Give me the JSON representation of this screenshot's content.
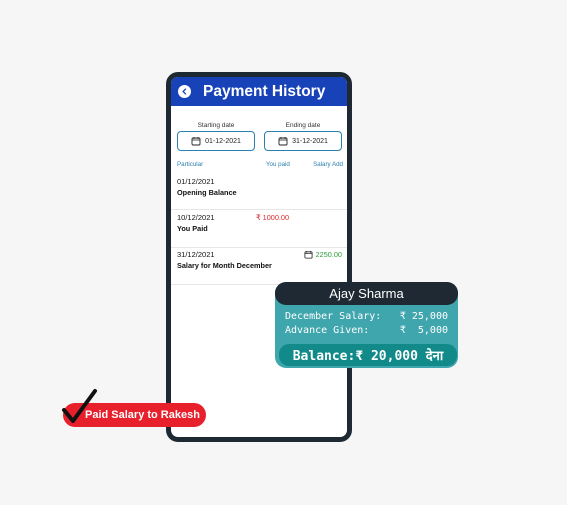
{
  "app": {
    "title": "Payment History",
    "back_icon": "chevron-left-icon",
    "header_color": "#1742b8"
  },
  "filters": {
    "start": {
      "label": "Starting date",
      "value": "01-12-2021",
      "icon": "calendar-icon"
    },
    "end": {
      "label": "Ending date",
      "value": "31-12-2021",
      "icon": "calendar-icon"
    }
  },
  "columns": {
    "particular": "Particular",
    "you_paid": "You paid",
    "salary_add": "Salary Add"
  },
  "entries": [
    {
      "date": "01/12/2021",
      "description": "Opening Balance",
      "paid": "",
      "salary": ""
    },
    {
      "date": "10/12/2021",
      "description": "You Paid",
      "paid": "₹ 1000.00",
      "salary": ""
    },
    {
      "date": "31/12/2021",
      "description": "Salary for Month December",
      "paid": "",
      "salary": "2250.00",
      "salary_icon": "receipt-icon"
    }
  ],
  "colors": {
    "paid": "#d42a2a",
    "salary": "#2d9a3a",
    "accent": "#2a7fb0"
  },
  "balance_card": {
    "name": "Ajay Sharma",
    "lines": [
      {
        "label": "December Salary:",
        "value": "₹ 25,000"
      },
      {
        "label": "Advance Given:",
        "value": "₹  5,000"
      }
    ],
    "balance_text": "Balance:₹ 20,000 देना",
    "colors": {
      "card": "#3fa6ad",
      "header": "#1f2933",
      "pill": "#128a8a"
    }
  },
  "badge": {
    "text": "Paid Salary to Rakesh",
    "icon": "checkmark-icon",
    "color": "#e8202b"
  }
}
